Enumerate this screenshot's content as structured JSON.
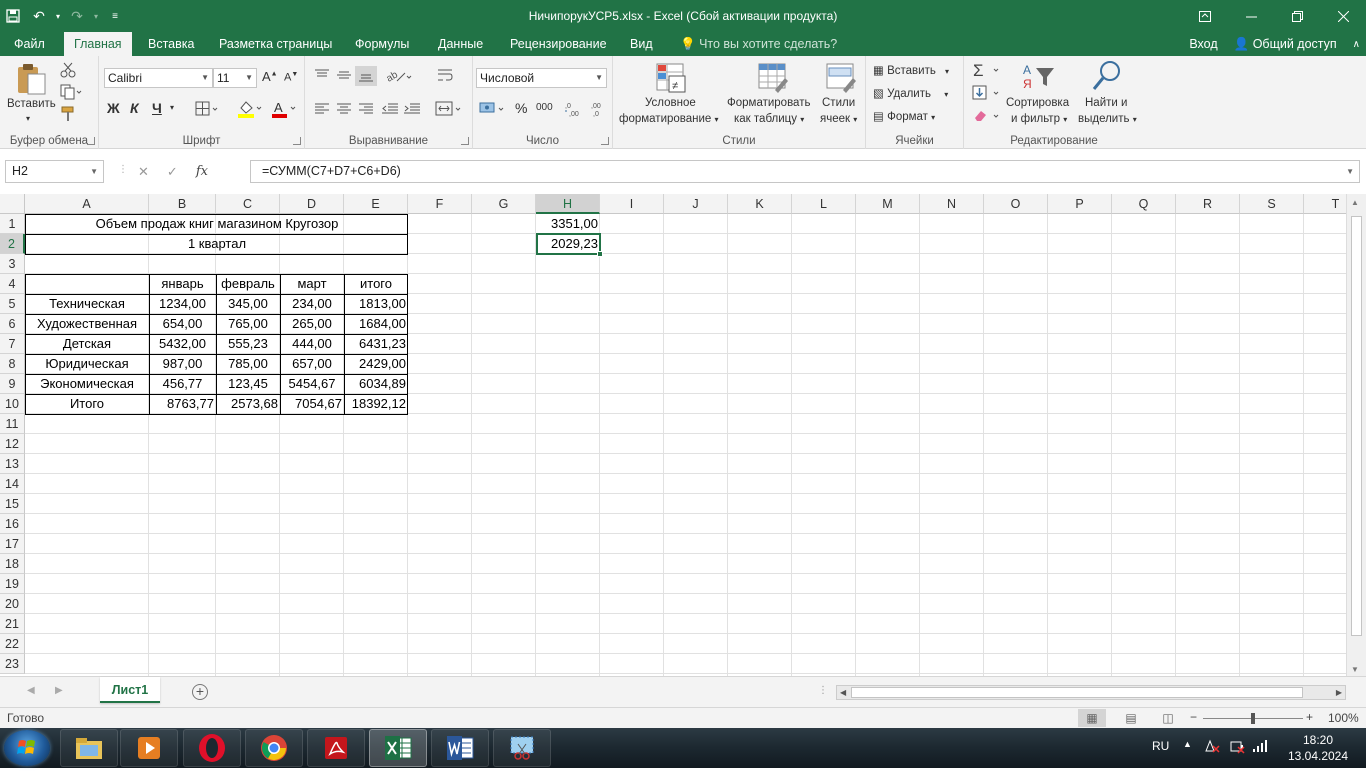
{
  "window": {
    "title": "НичипорукУСР5.xlsx - Excel (Сбой активации продукта)"
  },
  "tabs": [
    {
      "label": "Файл"
    },
    {
      "label": "Главная"
    },
    {
      "label": "Вставка"
    },
    {
      "label": "Разметка страницы"
    },
    {
      "label": "Формулы"
    },
    {
      "label": "Данные"
    },
    {
      "label": "Рецензирование"
    },
    {
      "label": "Вид"
    }
  ],
  "tell_me": "Что вы хотите сделать?",
  "signin": "Вход",
  "share": "Общий доступ",
  "ribbon": {
    "clipboard": {
      "label": "Буфер обмена",
      "paste": "Вставить"
    },
    "font": {
      "label": "Шрифт",
      "name": "Calibri",
      "size": "11",
      "bold": "Ж",
      "italic": "К",
      "underline": "Ч"
    },
    "alignment": {
      "label": "Выравнивание"
    },
    "number": {
      "label": "Число",
      "format": "Числовой",
      "percent": "%",
      "thousands": "000"
    },
    "styles": {
      "label": "Стили",
      "conditional_1": "Условное",
      "conditional_2": "форматирование",
      "table_1": "Форматировать",
      "table_2": "как таблицу",
      "cell_1": "Стили",
      "cell_2": "ячеек"
    },
    "cells": {
      "label": "Ячейки",
      "insert": "Вставить",
      "delete": "Удалить",
      "format": "Формат"
    },
    "editing": {
      "label": "Редактирование",
      "sort_1": "Сортировка",
      "sort_2": "и фильтр",
      "find_1": "Найти и",
      "find_2": "выделить"
    }
  },
  "formula_bar": {
    "name_box": "H2",
    "fx": "fx",
    "formula": "=СУММ(C7+D7+C6+D6)"
  },
  "sheet": {
    "columns": [
      "A",
      "B",
      "C",
      "D",
      "E",
      "F",
      "G",
      "H",
      "I",
      "J",
      "K",
      "L",
      "M",
      "N",
      "O",
      "P",
      "Q",
      "R",
      "S",
      "T"
    ],
    "rows": [
      "1",
      "2",
      "3",
      "4",
      "5",
      "6",
      "7",
      "8",
      "9",
      "10",
      "11",
      "12",
      "13",
      "14",
      "15",
      "16",
      "17",
      "18",
      "19",
      "20",
      "21",
      "22",
      "23"
    ],
    "selected_cell": "H2",
    "title": "Объем продаж книг магазином Кругозор",
    "subtitle": "1 квартал",
    "header": [
      "",
      "январь",
      "февраль",
      "март",
      "итого"
    ],
    "data": [
      [
        "Техническая",
        "1234,00",
        "345,00",
        "234,00",
        "1813,00"
      ],
      [
        "Художественная",
        "654,00",
        "765,00",
        "265,00",
        "1684,00"
      ],
      [
        "Детская",
        "5432,00",
        "555,23",
        "444,00",
        "6431,23"
      ],
      [
        "Юридическая",
        "987,00",
        "785,00",
        "657,00",
        "2429,00"
      ],
      [
        "Экономическая",
        "456,77",
        "123,45",
        "5454,67",
        "6034,89"
      ],
      [
        "Итого",
        "8763,77",
        "2573,68",
        "7054,67",
        "18392,12"
      ]
    ],
    "h1": "3351,00",
    "h2": "2029,23"
  },
  "sheet_tabs": [
    "Лист1"
  ],
  "status": {
    "ready": "Готово",
    "zoom": "100%"
  },
  "taskbar": {
    "lang": "RU",
    "time": "18:20",
    "date": "13.04.2024"
  }
}
